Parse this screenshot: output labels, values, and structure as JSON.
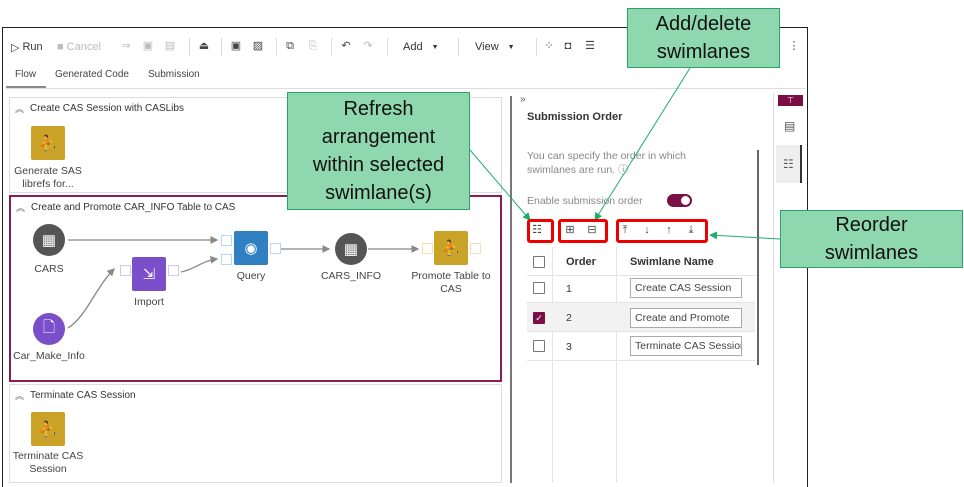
{
  "toolbar": {
    "run": "Run",
    "cancel": "Cancel",
    "add": "Add",
    "view": "View"
  },
  "tabs": [
    {
      "label": "Flow",
      "active": true
    },
    {
      "label": "Generated Code"
    },
    {
      "label": "Submission"
    }
  ],
  "swimlanes": [
    {
      "title": "Create CAS Session with CASLibs",
      "nodes": [
        {
          "label": "Generate SAS librefs for...",
          "color": "#c9a227"
        }
      ]
    },
    {
      "title": "Create and Promote CAR_INFO Table to CAS",
      "selected": true,
      "nodes": [
        {
          "label": "CARS",
          "color": "#555555"
        },
        {
          "label": "Car_Make_Info",
          "color": "#7b4fc9"
        },
        {
          "label": "Import",
          "color": "#7b4fc9"
        },
        {
          "label": "Query",
          "color": "#2f7fc1"
        },
        {
          "label": "CARS_INFO",
          "color": "#555555"
        },
        {
          "label": "Promote Table to CAS",
          "color": "#c9a227"
        }
      ]
    },
    {
      "title": "Terminate CAS Session",
      "nodes": [
        {
          "label": "Terminate CAS Session",
          "color": "#c9a227"
        }
      ]
    }
  ],
  "panel": {
    "collapse": "»",
    "title": "Submission Order",
    "description": "You can specify the order in which swimlanes are run.",
    "toggle_label": "Enable submission order",
    "toggle_on": true,
    "columns": [
      "Order",
      "Swimlane Name"
    ],
    "rows": [
      {
        "order": "1",
        "name": "Create CAS Session",
        "checked": false
      },
      {
        "order": "2",
        "name": "Create and Promote",
        "checked": true
      },
      {
        "order": "3",
        "name": "Terminate CAS Session",
        "checked": false
      }
    ]
  },
  "callouts": {
    "add_delete": "Add/delete swimlanes",
    "refresh": "Refresh arrangement within selected swimlane(s)",
    "reorder": "Reorder swimlanes"
  },
  "colors": {
    "accent": "#7a0f45",
    "callout": "#8fd7ae",
    "highlight": "#ee0000"
  }
}
